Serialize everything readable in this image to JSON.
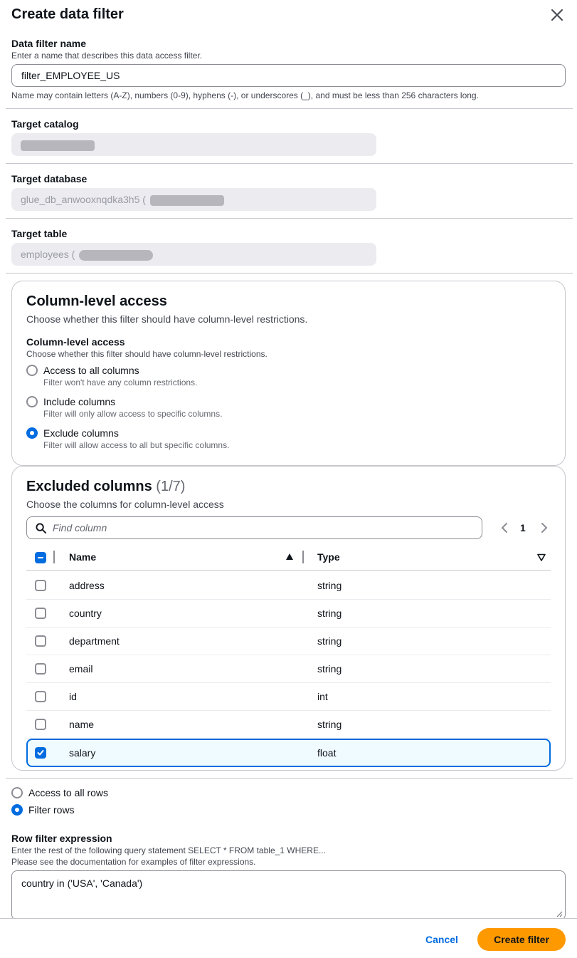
{
  "modal": {
    "title": "Create data filter",
    "close_label": "close"
  },
  "filter_name": {
    "label": "Data filter name",
    "description": "Enter a name that describes this data access filter.",
    "value": "filter_EMPLOYEE_US",
    "constraint": "Name may contain letters (A-Z), numbers (0-9), hyphens (-), or underscores (_), and must be less than 256 characters long."
  },
  "target_catalog": {
    "label": "Target catalog",
    "value": ""
  },
  "target_database": {
    "label": "Target database",
    "value": "glue_db_anwooxnqdka3h5 ("
  },
  "target_table": {
    "label": "Target table",
    "value": "employees ("
  },
  "column_access": {
    "heading": "Column-level access",
    "heading_desc": "Choose whether this filter should have column-level restrictions.",
    "field_label": "Column-level access",
    "field_desc": "Choose whether this filter should have column-level restrictions.",
    "options": [
      {
        "label": "Access to all columns",
        "sub": "Filter won't have any column restrictions.",
        "checked": false
      },
      {
        "label": "Include columns",
        "sub": "Filter will only allow access to specific columns.",
        "checked": false
      },
      {
        "label": "Exclude columns",
        "sub": "Filter will allow access to all but specific columns.",
        "checked": true
      }
    ]
  },
  "excluded_columns": {
    "heading": "Excluded columns",
    "count": "(1/7)",
    "description": "Choose the columns for column-level access",
    "search_placeholder": "Find column",
    "page": "1",
    "headers": {
      "name": "Name",
      "type": "Type"
    },
    "rows": [
      {
        "name": "address",
        "type": "string",
        "checked": false
      },
      {
        "name": "country",
        "type": "string",
        "checked": false
      },
      {
        "name": "department",
        "type": "string",
        "checked": false
      },
      {
        "name": "email",
        "type": "string",
        "checked": false
      },
      {
        "name": "id",
        "type": "int",
        "checked": false
      },
      {
        "name": "name",
        "type": "string",
        "checked": false
      },
      {
        "name": "salary",
        "type": "float",
        "checked": true
      }
    ]
  },
  "row_access": {
    "options": [
      {
        "label": "Access to all rows",
        "checked": false
      },
      {
        "label": "Filter rows",
        "checked": true
      }
    ]
  },
  "row_filter": {
    "label": "Row filter expression",
    "desc1": "Enter the rest of the following query statement SELECT * FROM table_1 WHERE...",
    "desc2": "Please see the documentation for examples of filter expressions.",
    "value": "country in ('USA', 'Canada')"
  },
  "footer": {
    "cancel": "Cancel",
    "create": "Create filter"
  },
  "colors": {
    "primary_button": "#ff9900",
    "accent": "#006ce0",
    "selected_row_bg": "#f0fbff"
  }
}
